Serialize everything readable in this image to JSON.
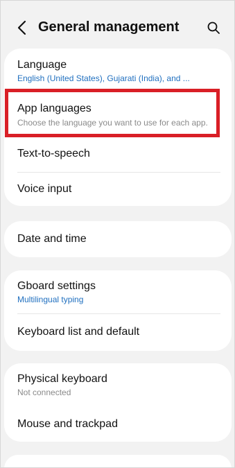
{
  "header": {
    "title": "General management"
  },
  "cards": [
    {
      "items": [
        {
          "label": "Language",
          "sub": "English (United States), Gujarati (India), and ..."
        },
        {
          "label": "App languages",
          "sub": "Choose the language you want to use for each app."
        },
        {
          "label": "Text-to-speech"
        },
        {
          "label": "Voice input"
        }
      ]
    },
    {
      "items": [
        {
          "label": "Date and time"
        }
      ]
    },
    {
      "items": [
        {
          "label": "Gboard settings",
          "sub": "Multilingual typing"
        },
        {
          "label": "Keyboard list and default"
        }
      ]
    },
    {
      "items": [
        {
          "label": "Physical keyboard",
          "sub": "Not connected"
        },
        {
          "label": "Mouse and trackpad"
        }
      ]
    }
  ],
  "colors": {
    "accent_blue": "#1f6fbf",
    "highlight_red": "#d91f26",
    "background": "#f2f2f2"
  }
}
